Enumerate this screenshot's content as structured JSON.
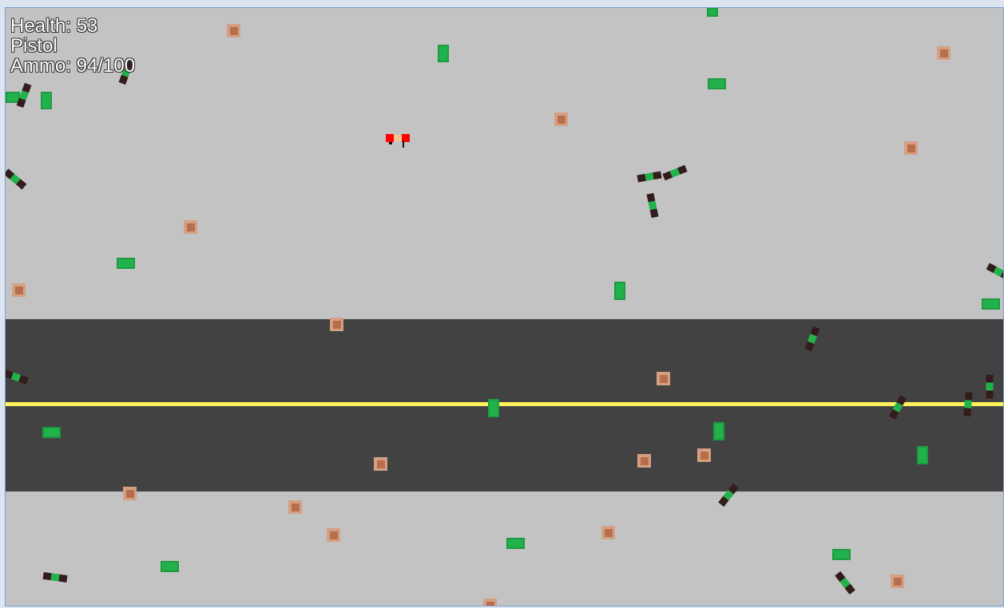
{
  "hud": {
    "health_label": "Health: 53",
    "weapon_label": "Pistol",
    "ammo_label": "Ammo: 94/100"
  },
  "colors": {
    "grass": "#c3c3c3",
    "road": "#424242",
    "road_line": "#fff25a",
    "crate_outer": "#d3a083",
    "crate_inner": "#b86e4b",
    "bush": "#21b24b",
    "zombie_body": "#331c1c",
    "player": "#ff0000"
  }
}
